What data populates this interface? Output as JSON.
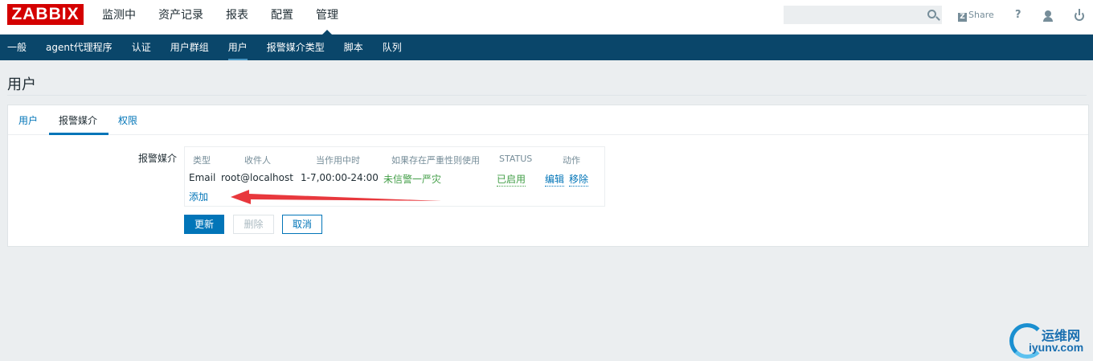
{
  "logo": "ZABBIX",
  "main_nav": [
    "监测中",
    "资产记录",
    "报表",
    "配置",
    "管理"
  ],
  "main_nav_active": "管理",
  "header": {
    "search_value": "",
    "share_label": "Share",
    "help_label": "?"
  },
  "sub_nav": [
    "一般",
    "agent代理程序",
    "认证",
    "用户群组",
    "用户",
    "报警媒介类型",
    "脚本",
    "队列"
  ],
  "sub_nav_active": "用户",
  "page_title": "用户",
  "tabs": [
    "用户",
    "报警媒介",
    "权限"
  ],
  "active_tab": "报警媒介",
  "form": {
    "label": "报警媒介",
    "columns": [
      "类型",
      "收件人",
      "当作用中时",
      "如果存在严重性则使用",
      "STATUS",
      "动作"
    ],
    "rows": [
      {
        "type": "Email",
        "recipient": "root@localhost",
        "when_active": "1-7,00:00-24:00",
        "severity": "未信警一严灾",
        "status": "已启用",
        "action_edit": "编辑",
        "action_remove": "移除"
      }
    ],
    "add_label": "添加"
  },
  "buttons": {
    "update": "更新",
    "delete": "删除",
    "cancel": "取消"
  },
  "watermark": {
    "cn": "运维网",
    "en": "iyunv.com"
  },
  "colors": {
    "nav_dark": "#0a466a",
    "link": "#0275b8",
    "logo_red": "#d40000",
    "status_green": "#429e47",
    "annotation_arrow": "#e8383d"
  }
}
